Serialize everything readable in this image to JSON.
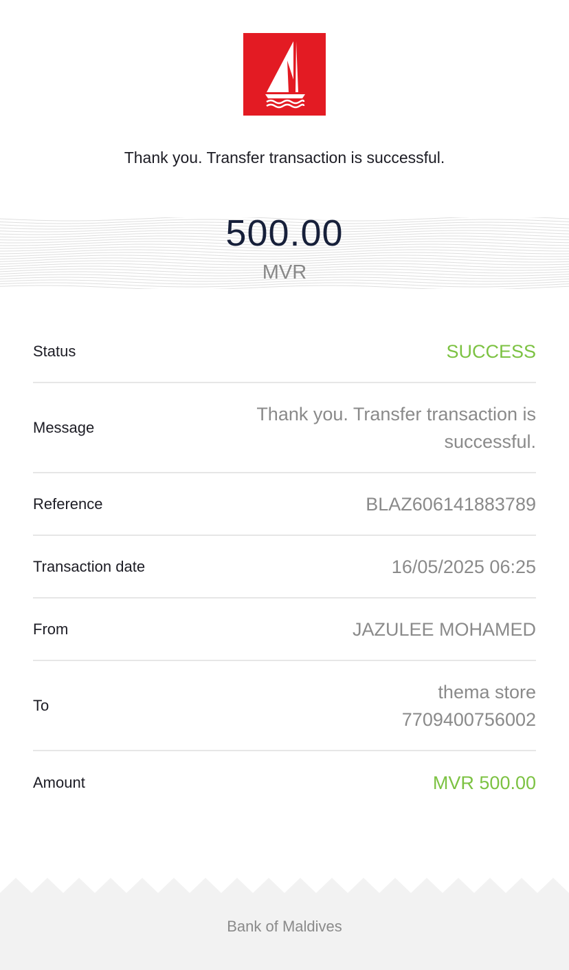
{
  "logo": {
    "icon": "sailboat-logo-icon",
    "color": "#e31b23"
  },
  "headline": "Thank you. Transfer transaction is successful.",
  "amount": {
    "value": "500.00",
    "currency": "MVR"
  },
  "details": {
    "status": {
      "label": "Status",
      "value": "SUCCESS"
    },
    "message": {
      "label": "Message",
      "line1": "Thank you. Transfer transaction is",
      "line2": "successful."
    },
    "reference": {
      "label": "Reference",
      "value": "BLAZ606141883789"
    },
    "transaction_date": {
      "label": "Transaction date",
      "value": "16/05/2025 06:25"
    },
    "from": {
      "label": "From",
      "value": "JAZULEE MOHAMED"
    },
    "to": {
      "label": "To",
      "line1": "thema store",
      "line2": "7709400756002"
    },
    "amount": {
      "label": "Amount",
      "value": "MVR 500.00"
    }
  },
  "footer": {
    "text": "Bank of Maldives"
  },
  "colors": {
    "brand_red": "#e31b23",
    "success_green": "#7cc242",
    "amount_navy": "#17203a"
  }
}
